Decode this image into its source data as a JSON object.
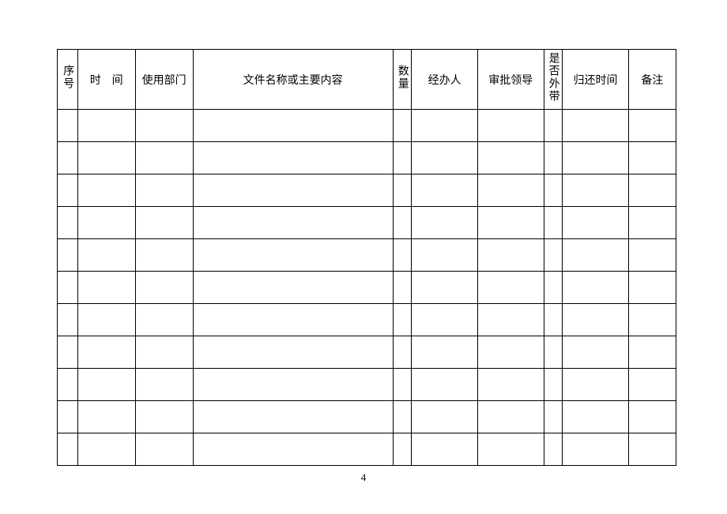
{
  "headers": {
    "seq": "序号",
    "time": "时　间",
    "dept": "使用部门",
    "filename": "文件名称或主要内容",
    "qty": "数量",
    "handler": "经办人",
    "approver": "审批领导",
    "takeout": "是否外带",
    "return_time": "归还时间",
    "remark": "备注"
  },
  "rows": [
    {
      "seq": "",
      "time": "",
      "dept": "",
      "filename": "",
      "qty": "",
      "handler": "",
      "approver": "",
      "takeout": "",
      "return_time": "",
      "remark": ""
    },
    {
      "seq": "",
      "time": "",
      "dept": "",
      "filename": "",
      "qty": "",
      "handler": "",
      "approver": "",
      "takeout": "",
      "return_time": "",
      "remark": ""
    },
    {
      "seq": "",
      "time": "",
      "dept": "",
      "filename": "",
      "qty": "",
      "handler": "",
      "approver": "",
      "takeout": "",
      "return_time": "",
      "remark": ""
    },
    {
      "seq": "",
      "time": "",
      "dept": "",
      "filename": "",
      "qty": "",
      "handler": "",
      "approver": "",
      "takeout": "",
      "return_time": "",
      "remark": ""
    },
    {
      "seq": "",
      "time": "",
      "dept": "",
      "filename": "",
      "qty": "",
      "handler": "",
      "approver": "",
      "takeout": "",
      "return_time": "",
      "remark": ""
    },
    {
      "seq": "",
      "time": "",
      "dept": "",
      "filename": "",
      "qty": "",
      "handler": "",
      "approver": "",
      "takeout": "",
      "return_time": "",
      "remark": ""
    },
    {
      "seq": "",
      "time": "",
      "dept": "",
      "filename": "",
      "qty": "",
      "handler": "",
      "approver": "",
      "takeout": "",
      "return_time": "",
      "remark": ""
    },
    {
      "seq": "",
      "time": "",
      "dept": "",
      "filename": "",
      "qty": "",
      "handler": "",
      "approver": "",
      "takeout": "",
      "return_time": "",
      "remark": ""
    },
    {
      "seq": "",
      "time": "",
      "dept": "",
      "filename": "",
      "qty": "",
      "handler": "",
      "approver": "",
      "takeout": "",
      "return_time": "",
      "remark": ""
    },
    {
      "seq": "",
      "time": "",
      "dept": "",
      "filename": "",
      "qty": "",
      "handler": "",
      "approver": "",
      "takeout": "",
      "return_time": "",
      "remark": ""
    },
    {
      "seq": "",
      "time": "",
      "dept": "",
      "filename": "",
      "qty": "",
      "handler": "",
      "approver": "",
      "takeout": "",
      "return_time": "",
      "remark": ""
    }
  ],
  "page_number": "4"
}
